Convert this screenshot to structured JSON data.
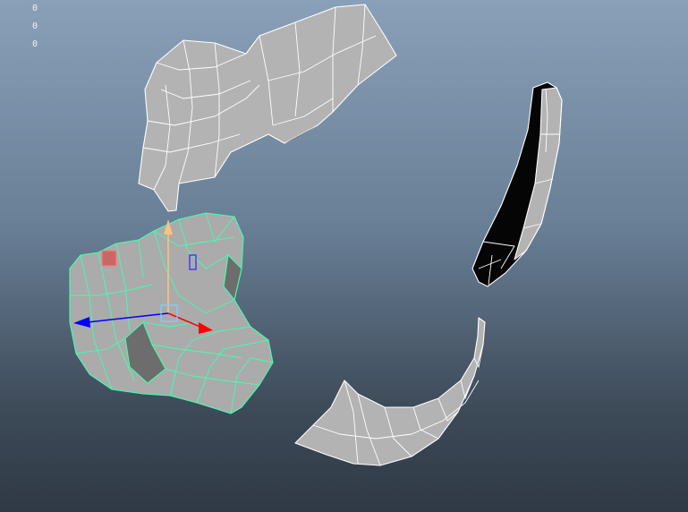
{
  "viewport": {
    "background_top": "#8aa0b8",
    "background_bottom": "#2f3945"
  },
  "hud": {
    "lines": [
      "0",
      "0",
      "0"
    ]
  },
  "manipulator": {
    "x_axis_color": "#ff0000",
    "y_axis_color": "#ffc080",
    "z_axis_color": "#0000ff",
    "selection_wire_color": "#40ffb0"
  }
}
